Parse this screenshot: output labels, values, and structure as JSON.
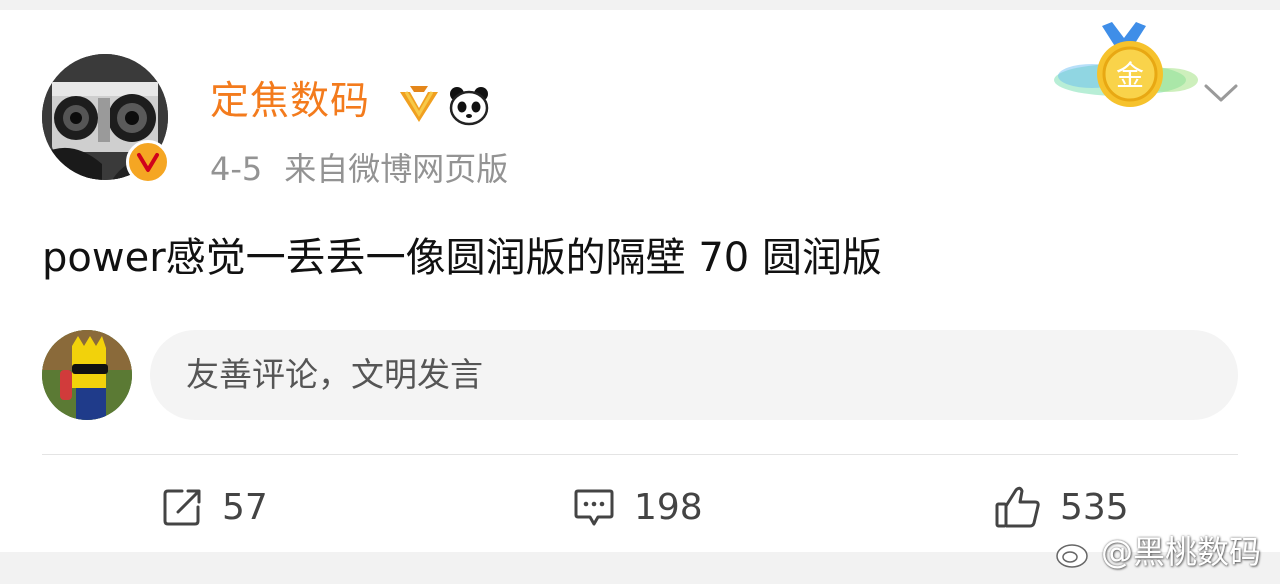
{
  "post": {
    "author": "定焦数码",
    "date": "4-5",
    "source": "来自微博网页版",
    "text": "power感觉一丢丢一像圆润版的隔壁 70 圆润版",
    "medal_char": "金"
  },
  "comment_box": {
    "placeholder": "友善评论，文明发言"
  },
  "actions": {
    "repost_count": "57",
    "comment_count": "198",
    "like_count": "535"
  },
  "watermark": {
    "text": "@黑桃数码"
  },
  "colors": {
    "username": "#f37b1d",
    "verified_badge": "#f5a623",
    "meta_text": "#939393",
    "post_text": "#111111",
    "input_bg": "#f4f4f4",
    "icon": "#444444"
  }
}
